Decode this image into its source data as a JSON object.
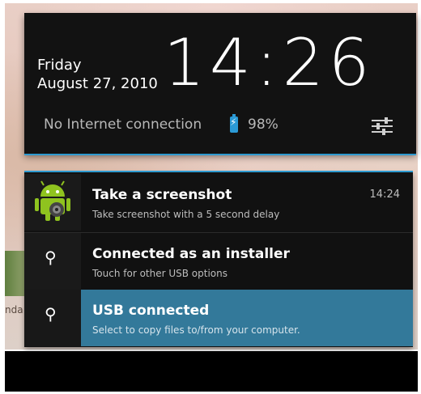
{
  "status": {
    "day": "Friday",
    "date": "August 27, 2010",
    "clock": "14:26",
    "connection": "No Internet connection",
    "battery": "98%"
  },
  "notifications": [
    {
      "title": "Take a screenshot",
      "subtitle": "Take screenshot with a 5 second delay",
      "time": "14:24",
      "icon": "android-robot-icon"
    },
    {
      "title": "Connected as an installer",
      "subtitle": "Touch for other USB options",
      "icon": "usb-icon"
    },
    {
      "title": "USB connected",
      "subtitle": "Select to copy files to/from your computer.",
      "icon": "usb-icon",
      "highlight": "#33799a"
    }
  ],
  "desktop": {
    "peek_label": "nda"
  },
  "colors": {
    "accent": "#2e9ad0",
    "panel": "#121212",
    "highlight": "#33799a"
  }
}
